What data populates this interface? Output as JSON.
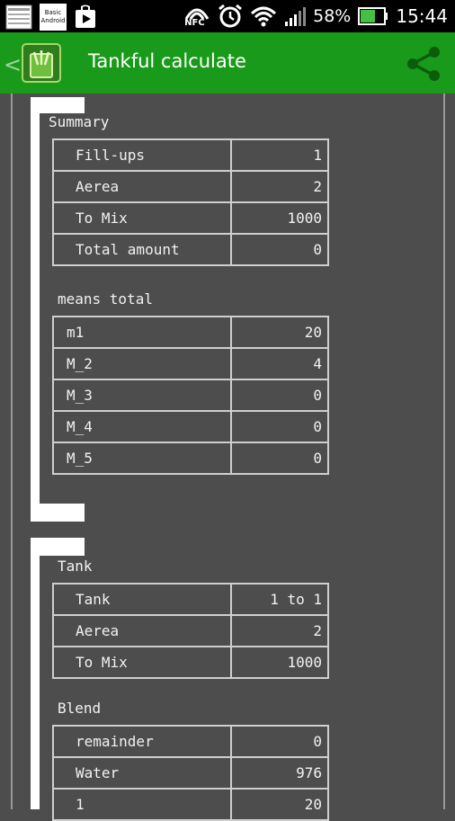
{
  "status_bar": {
    "notification_app_label": "Basic Android",
    "icons": [
      "app-thumbnail-icon",
      "play-store-icon",
      "nfc-icon",
      "alarm-icon",
      "wifi-icon",
      "signal-icon",
      "battery-icon"
    ],
    "nfc_label": "NFC",
    "battery_percent": "58%",
    "time": "15:44"
  },
  "action_bar": {
    "back_glyph": "<",
    "title": "Tankful calculate",
    "color": "#1a9a1a"
  },
  "summary": {
    "section_title": "Summary",
    "rows": [
      {
        "label": "Fill-ups",
        "value": "1"
      },
      {
        "label": "Aerea",
        "value": "2"
      },
      {
        "label": "To Mix",
        "value": "1000"
      },
      {
        "label": "Total amount",
        "value": "0"
      }
    ],
    "means_title": "means total",
    "means_rows": [
      {
        "label": "m1",
        "value": "20"
      },
      {
        "label": "M_2",
        "value": "4"
      },
      {
        "label": "M_3",
        "value": "0"
      },
      {
        "label": "M_4",
        "value": "0"
      },
      {
        "label": "M_5",
        "value": "0"
      }
    ]
  },
  "tank": {
    "section_title": "Tank",
    "rows": [
      {
        "label": "Tank",
        "value": "1 to 1"
      },
      {
        "label": "Aerea",
        "value": "2"
      },
      {
        "label": "To Mix",
        "value": "1000"
      }
    ],
    "blend_title": "Blend",
    "blend_rows": [
      {
        "label": "remainder",
        "value": "0"
      },
      {
        "label": "Water",
        "value": "976"
      },
      {
        "label": "1",
        "value": "20"
      }
    ]
  }
}
